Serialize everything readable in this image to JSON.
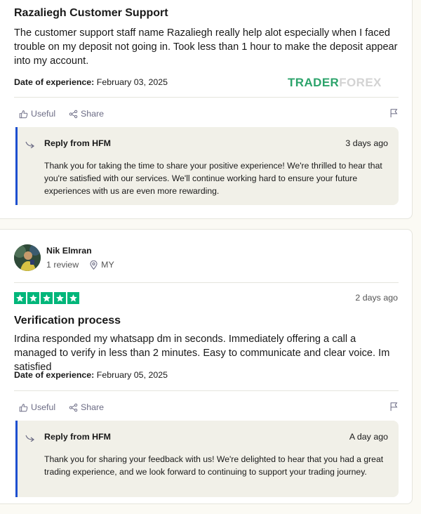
{
  "reviews": [
    {
      "title": "Razaliegh Customer Support",
      "body": "The customer support staff name Razaliegh really help alot especially when I faced trouble on my deposit not going in. Took less than 1 hour to make the deposit appear into my account.",
      "date_label": "Date of experience:",
      "date_value": "February 03, 2025",
      "useful_label": "Useful",
      "share_label": "Share",
      "reply": {
        "from": "Reply from HFM",
        "time": "3 days ago",
        "text": "Thank you for taking the time to share your positive experience! We're thrilled to hear that you're satisfied with our services. We'll continue working hard to ensure your future experiences with us are even more rewarding."
      }
    },
    {
      "reviewer_name": "Nik Elmran",
      "review_count": "1 review",
      "country": "MY",
      "rating": 5,
      "posted": "2 days ago",
      "title": "Verification process",
      "body": "Irdina responded my whatsapp dm in seconds. Immediately offering a call a managed to verify in less than 2 minutes. Easy to communicate and clear voice. Im satisfied",
      "date_label": "Date of experience:",
      "date_value": "February 05, 2025",
      "useful_label": "Useful",
      "share_label": "Share",
      "reply": {
        "from": "Reply from HFM",
        "time": "A day ago",
        "text": "Thank you for sharing your feedback with us! We're delighted to hear that you had a great trading experience, and we look forward to continuing to support your trading journey."
      }
    }
  ],
  "watermark": {
    "part1": "TRADER",
    "part2": "FOREX"
  },
  "colors": {
    "star_green": "#00b67a",
    "reply_border": "#1d4fd0",
    "reply_bg": "#f1f0e8"
  },
  "icons": [
    "thumbs-up-icon",
    "share-icon",
    "flag-icon",
    "reply-arrow-icon",
    "location-pin-icon",
    "star-icon"
  ]
}
